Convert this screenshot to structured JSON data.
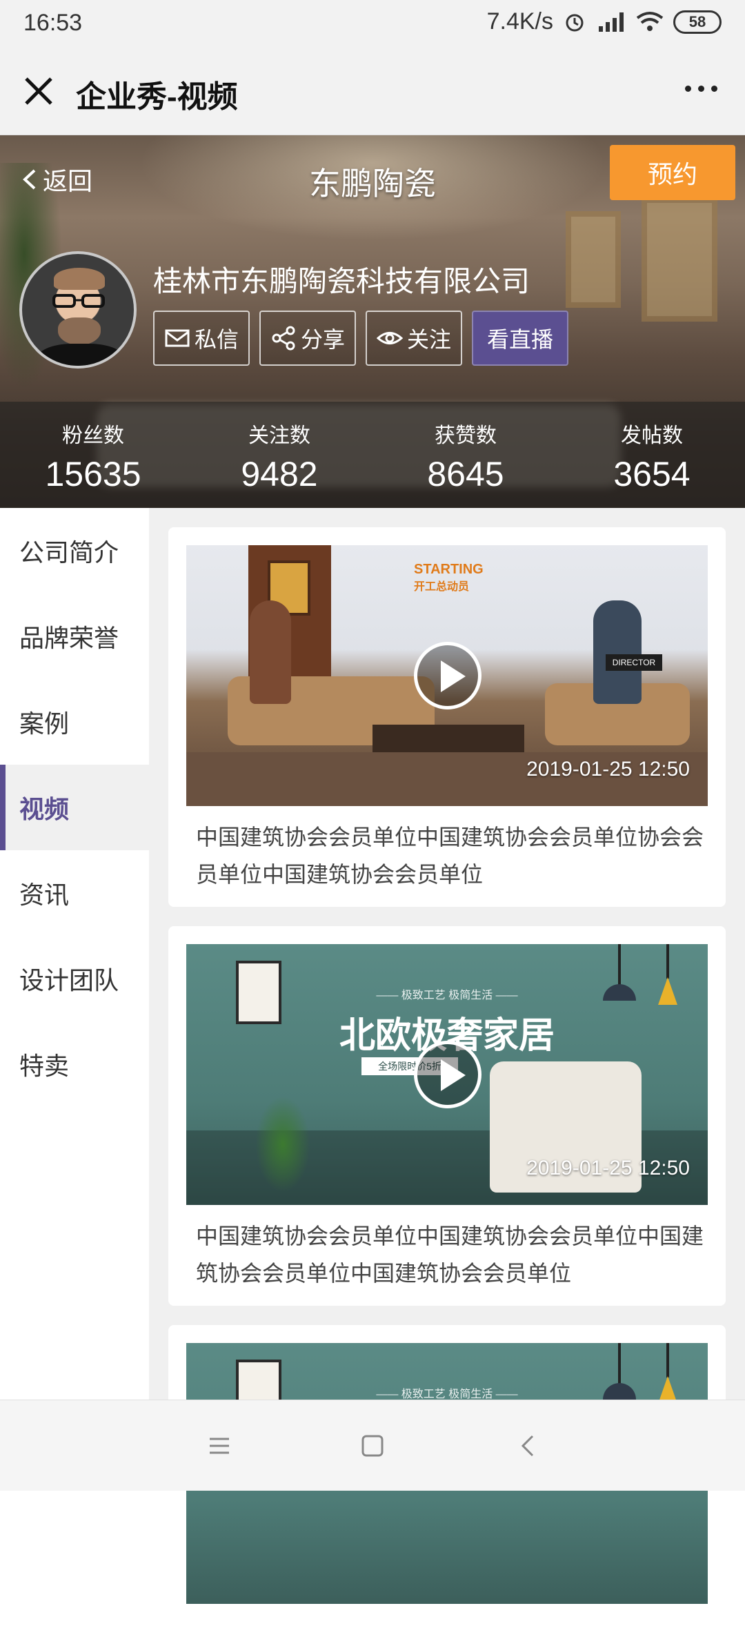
{
  "status_bar": {
    "time": "16:53",
    "network_speed": "7.4K/s",
    "icons": [
      "alarm-icon",
      "signal-icon",
      "wifi-icon"
    ],
    "battery": "58"
  },
  "title_bar": {
    "title": "企业秀-视频"
  },
  "hero": {
    "back_label": "返回",
    "title": "东鹏陶瓷",
    "book_label": "预约",
    "company_name": "桂林市东鹏陶瓷科技有限公司",
    "actions": {
      "message": "私信",
      "share": "分享",
      "follow": "关注",
      "live": "看直播"
    },
    "stats": [
      {
        "label": "粉丝数",
        "value": "15635"
      },
      {
        "label": "关注数",
        "value": "9482"
      },
      {
        "label": "获赞数",
        "value": "8645"
      },
      {
        "label": "发帖数",
        "value": "3654"
      }
    ]
  },
  "sidebar": {
    "items": [
      {
        "label": "公司简介"
      },
      {
        "label": "品牌荣誉"
      },
      {
        "label": "案例"
      },
      {
        "label": "视频"
      },
      {
        "label": "资讯"
      },
      {
        "label": "设计团队"
      },
      {
        "label": "特卖"
      }
    ],
    "active_index": 3
  },
  "videos": [
    {
      "time": "2019-01-25 12:50",
      "description": "中国建筑协会会员单位中国建筑协会会员单位协会会员单位中国建筑协会会员单位",
      "thumb_text": {
        "line1": "STARTING",
        "line2": "开工总动员",
        "tag": "DIRECTOR"
      }
    },
    {
      "time": "2019-01-25 12:50",
      "description": "中国建筑协会会员单位中国建筑协会会员单位中国建筑协会会员单位中国建筑协会会员单位",
      "thumb_text": {
        "sub": "—— 极致工艺 极简生活 ——",
        "headline": "北欧极奢家居",
        "ribbon": "全场限时价5折"
      }
    },
    {
      "thumb_text": {
        "sub": "—— 极致工艺 极简生活 ——"
      }
    }
  ],
  "colors": {
    "accent": "#5b4f91",
    "book_button": "#f7982f"
  }
}
